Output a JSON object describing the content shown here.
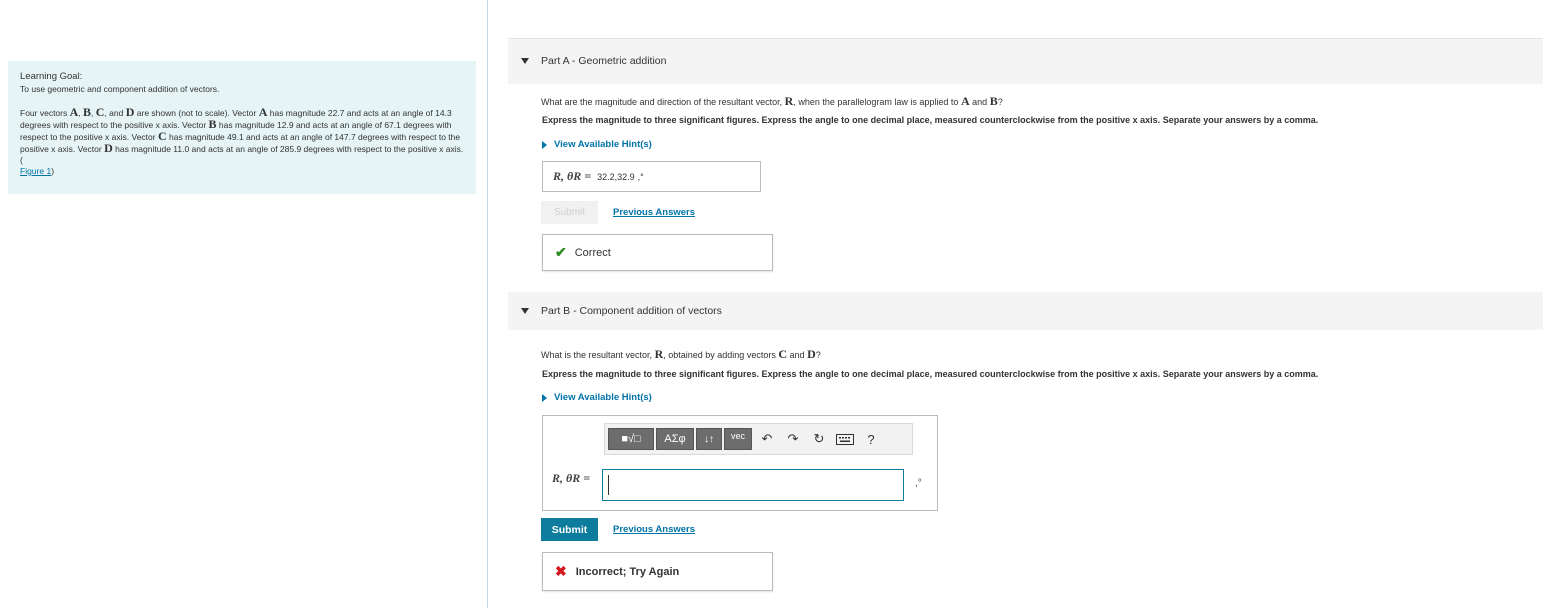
{
  "learning_goal": {
    "title": "Learning Goal:",
    "text": "To use geometric and component addition of vectors.",
    "problem_prefix": "Four vectors",
    "vectors": [
      "A",
      "B",
      "C",
      "D"
    ],
    "problem_mid1": "are shown (not to scale). Vector",
    "a_text": "has magnitude 22.7 and acts at an angle of 14.3 degrees with respect to the positive x axis. Vector",
    "b_text": "has magnitude 12.9 and acts at an angle of 67.1 degrees with respect to the positive x axis. Vector",
    "c_text": "has magnitude 49.1 and acts at an angle of 147.7 degrees with respect to the positive x axis. Vector",
    "d_text": "has magnitude 11.0 and acts at an angle of 285.9 degrees with respect to the positive x axis.(",
    "figure_link": "Figure 1",
    "figure_close": ")"
  },
  "part_a": {
    "header": "Part A - Geometric addition",
    "question_pre": "What are the magnitude and direction of the resultant vector,",
    "question_r": "R",
    "question_mid": ", when the parallelogram law is applied to",
    "question_a": "A",
    "question_and": "and",
    "question_b": "B",
    "question_end": "?",
    "instructions": "Express the magnitude to three significant figures. Express the angle to one decimal place, measured counterclockwise from the positive x axis. Separate your answers by a comma.",
    "hint_label": "View Available Hint(s)",
    "answer_label": "R, θR =",
    "answer_value": "32.2,32.9",
    "answer_unit": ",°",
    "submit_label": "Submit",
    "previous_answers": "Previous Answers",
    "feedback": "Correct"
  },
  "part_b": {
    "header": "Part B - Component addition of vectors",
    "question_pre": "What is the resultant vector,",
    "question_r": "R",
    "question_mid": ", obtained by adding vectors",
    "question_c": "C",
    "question_and": "and",
    "question_d": "D",
    "question_end": "?",
    "instructions": "Express the magnitude to three significant figures. Express the angle to one decimal place, measured counterclockwise from the positive x axis. Separate your answers by a comma.",
    "hint_label": "View Available Hint(s)",
    "toolbar": {
      "template_btn": "■√□",
      "greek_btn": "ΑΣφ",
      "arrows_btn": "↓↑",
      "vec_btn": "vec",
      "help": "?"
    },
    "answer_label": "R, θR =",
    "answer_value": "",
    "answer_unit": ",°",
    "submit_label": "Submit",
    "previous_answers": "Previous Answers",
    "feedback": "Incorrect; Try Again"
  },
  "colors": {
    "accent": "#0e7c9c",
    "link": "#0073a8",
    "goal_bg": "#e6f4f5",
    "correct": "#2e8b22",
    "incorrect": "#d3171e"
  }
}
